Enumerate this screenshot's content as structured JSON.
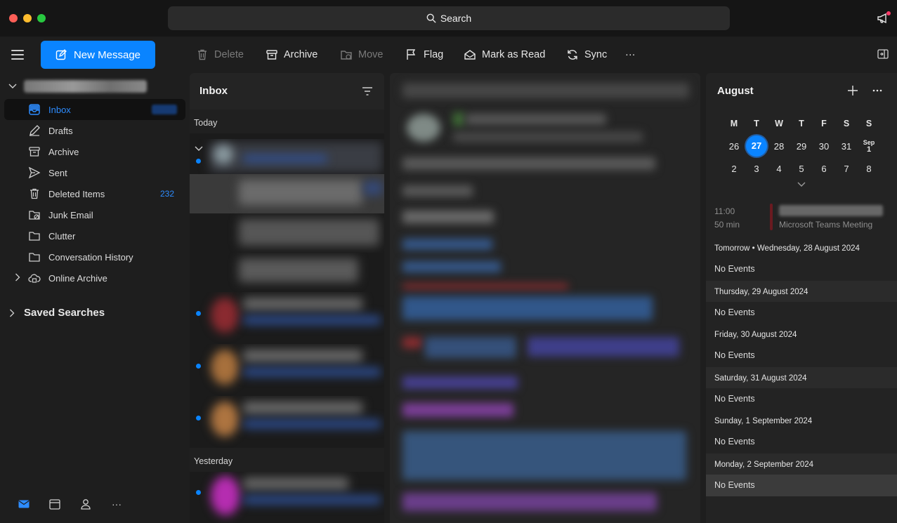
{
  "search": {
    "label": "Search"
  },
  "toolbar": {
    "new_message": "New Message",
    "delete": "Delete",
    "archive": "Archive",
    "move": "Move",
    "flag": "Flag",
    "mark_read": "Mark as Read",
    "sync": "Sync",
    "more": "···"
  },
  "sidebar": {
    "folders": [
      {
        "label": "Inbox",
        "icon": "inbox-icon"
      },
      {
        "label": "Drafts",
        "icon": "drafts-icon"
      },
      {
        "label": "Archive",
        "icon": "archive-icon"
      },
      {
        "label": "Sent",
        "icon": "sent-icon"
      },
      {
        "label": "Deleted Items",
        "icon": "trash-icon",
        "count": "232"
      },
      {
        "label": "Junk Email",
        "icon": "junk-icon"
      },
      {
        "label": "Clutter",
        "icon": "folder-icon"
      },
      {
        "label": "Conversation History",
        "icon": "folder-icon"
      },
      {
        "label": "Online Archive",
        "icon": "cloud-archive-icon"
      }
    ],
    "saved_searches": "Saved Searches",
    "bottom_nav_more": "···"
  },
  "message_list": {
    "title": "Inbox",
    "groups": [
      "Today",
      "Yesterday"
    ]
  },
  "calendar": {
    "month": "August",
    "weekday_headers": [
      "M",
      "T",
      "W",
      "T",
      "F",
      "S",
      "S"
    ],
    "week1": [
      "26",
      "27",
      "28",
      "29",
      "30",
      "31"
    ],
    "week1_last_month": "Sep",
    "week1_last_day": "1",
    "week2": [
      "2",
      "3",
      "4",
      "5",
      "6",
      "7",
      "8"
    ],
    "today": "27",
    "event": {
      "time": "11:00",
      "duration": "50 min",
      "location": "Microsoft Teams Meeting",
      "accent_color": "#6a1a20"
    },
    "days": [
      {
        "heading": "Tomorrow • Wednesday, 28 August 2024",
        "status": "No Events"
      },
      {
        "heading": "Thursday, 29 August 2024",
        "status": "No Events"
      },
      {
        "heading": "Friday, 30 August 2024",
        "status": "No Events"
      },
      {
        "heading": "Saturday, 31 August 2024",
        "status": "No Events"
      },
      {
        "heading": "Sunday, 1 September 2024",
        "status": "No Events"
      },
      {
        "heading": "Monday, 2 September 2024",
        "status": "No Events"
      }
    ]
  },
  "colors": {
    "accent": "#0a84ff",
    "background": "#1e1e1e",
    "unread_dot": "#0a84ff"
  }
}
